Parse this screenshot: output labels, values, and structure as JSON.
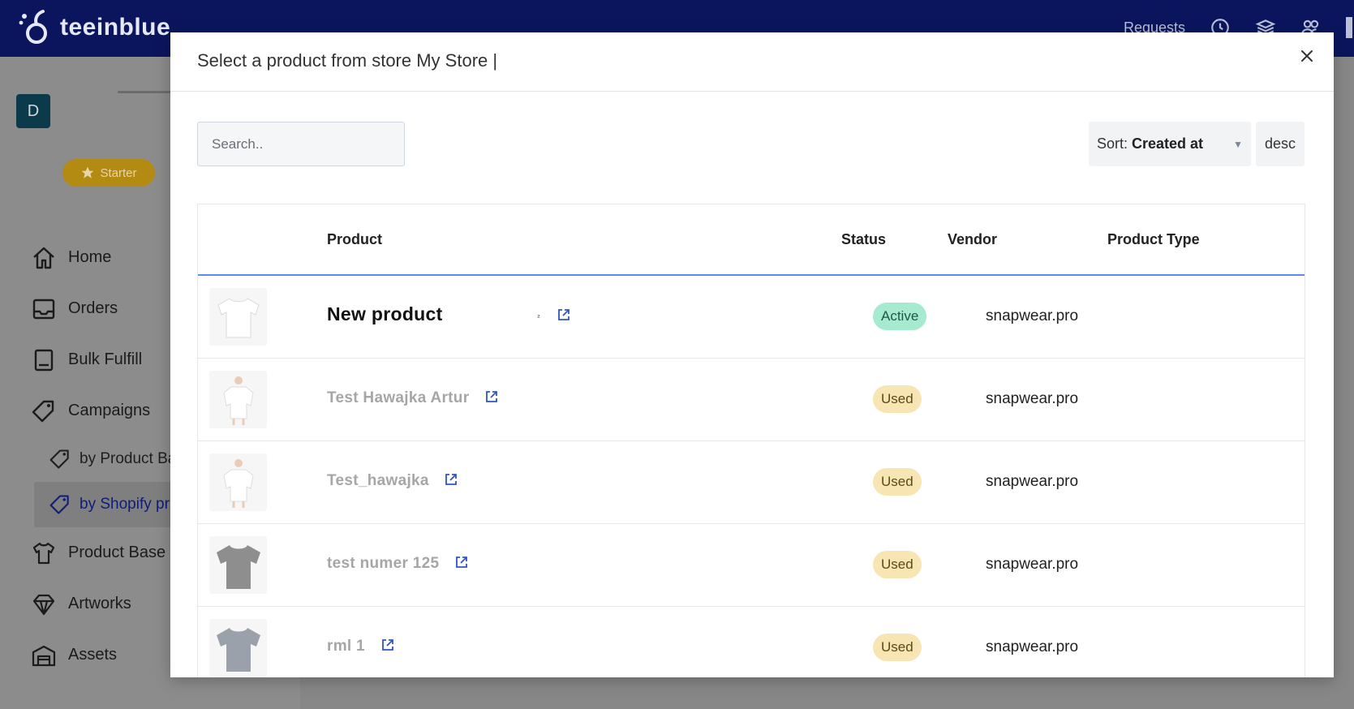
{
  "app": {
    "brand": "teeinblue",
    "topbar_right_label": "Requests",
    "avatar_letter": "D",
    "plan_badge": "Starter"
  },
  "sidebar": {
    "items": [
      {
        "label": "Home",
        "icon": "home-icon"
      },
      {
        "label": "Orders",
        "icon": "inbox-icon"
      },
      {
        "label": "Bulk Fulfill",
        "icon": "book-icon"
      },
      {
        "label": "Campaigns",
        "icon": "tag-icon"
      }
    ],
    "sub_items": [
      {
        "label": "by Product Ba",
        "icon": "tag-icon",
        "active": false
      },
      {
        "label": "by Shopify pr",
        "icon": "tag-icon",
        "active": true
      }
    ],
    "items_after": [
      {
        "label": "Product Base",
        "icon": "shirt-icon"
      },
      {
        "label": "Artworks",
        "icon": "diamond-icon"
      },
      {
        "label": "Assets",
        "icon": "warehouse-icon"
      }
    ]
  },
  "modal": {
    "title": "Select a product from store My Store |",
    "search_placeholder": "Search..",
    "sort_label": "Sort:",
    "sort_value": "Created at",
    "order_label": "desc",
    "columns": {
      "product": "Product",
      "status": "Status",
      "vendor": "Vendor",
      "product_type": "Product Type"
    },
    "rows": [
      {
        "name": "New product",
        "status": "Active",
        "vendor": "snapwear.pro",
        "product_type": "",
        "thumb": "white-tshirt",
        "mark": "²"
      },
      {
        "name": "Test Hawajka Artur",
        "status": "Used",
        "vendor": "snapwear.pro",
        "product_type": "",
        "thumb": "white-shirt-model"
      },
      {
        "name": "Test_hawajka",
        "status": "Used",
        "vendor": "snapwear.pro",
        "product_type": "",
        "thumb": "white-shirt-model"
      },
      {
        "name": "test numer 125",
        "status": "Used",
        "vendor": "snapwear.pro",
        "product_type": "",
        "thumb": "gray-tshirt"
      },
      {
        "name": "rml 1",
        "status": "Used",
        "vendor": "snapwear.pro",
        "product_type": "",
        "thumb": "gray-blue-tshirt"
      }
    ]
  },
  "colors": {
    "topbar": "#0a155e",
    "accent_blue": "#5b8def",
    "status_active": "#a6ead0",
    "status_used": "#f7e6b3",
    "plan_badge": "#e0a915"
  }
}
